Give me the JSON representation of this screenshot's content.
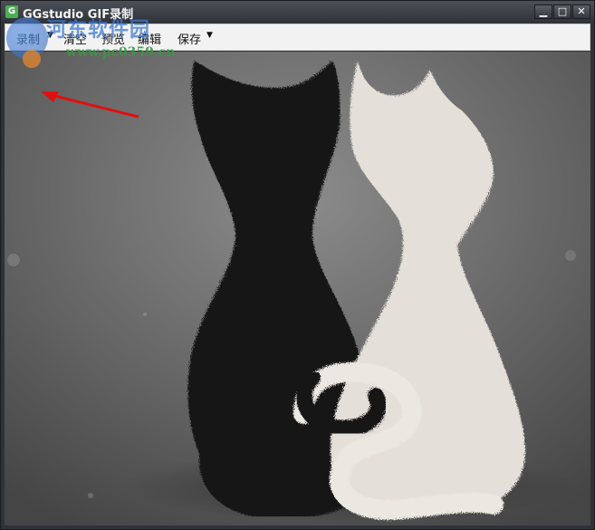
{
  "window": {
    "title": "GGstudio GIF录制",
    "app_icon_letter": "G",
    "controls": {
      "minimize": "▁",
      "maximize": "□",
      "close": "✕"
    }
  },
  "menu": {
    "record": "录制",
    "record_arrow": "▼",
    "clear": "清空",
    "preview": "预览",
    "edit": "编辑",
    "save": "保存",
    "save_arrow": "▼"
  },
  "watermark": {
    "title": "河东软件园",
    "url": "www.pc0359.cn"
  },
  "colors": {
    "titlebar": "#3b3f45",
    "menubar": "#f2f2f2",
    "arrow": "#e01010",
    "black_cat": "#141414",
    "white_cat": "#e6e2dc"
  }
}
